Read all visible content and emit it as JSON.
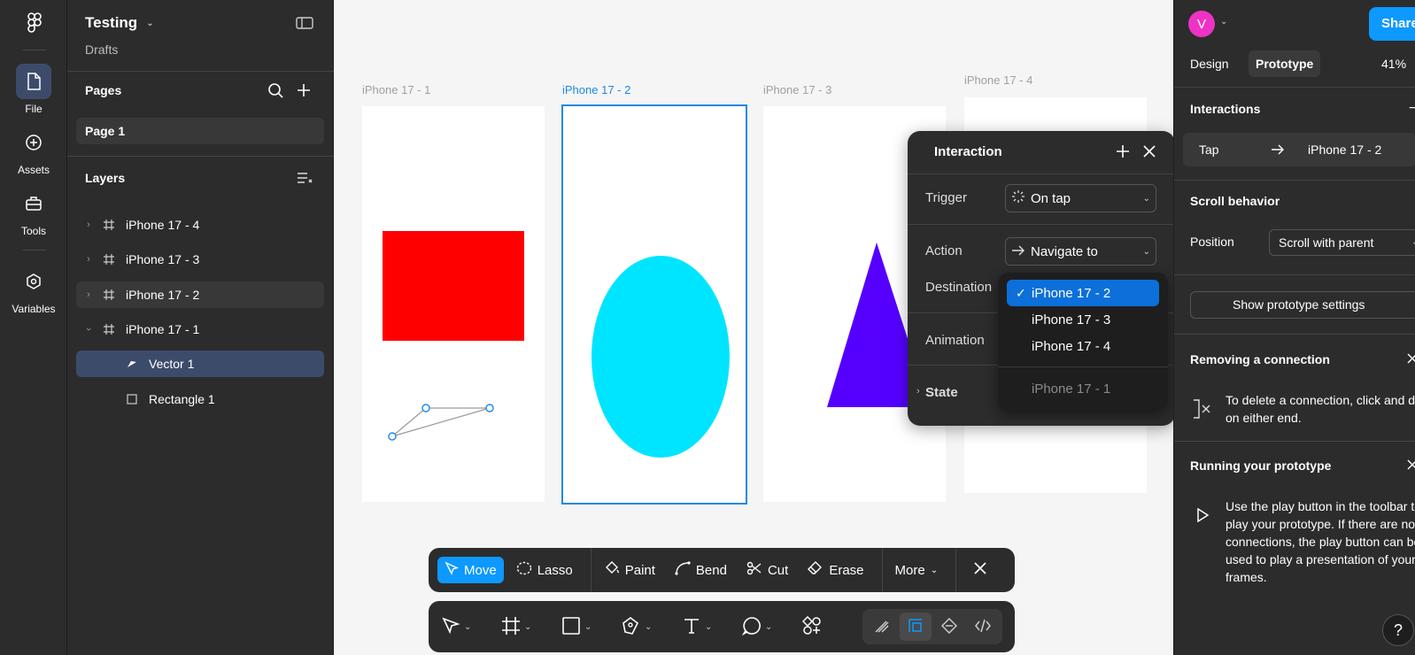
{
  "rail": {
    "items": [
      {
        "label": "File",
        "icon": "file-icon"
      },
      {
        "label": "Assets",
        "icon": "assets-icon"
      },
      {
        "label": "Tools",
        "icon": "toolbox-icon"
      },
      {
        "label": "Variables",
        "icon": "variables-icon"
      }
    ]
  },
  "project": {
    "title": "Testing",
    "subtitle": "Drafts"
  },
  "pages": {
    "title": "Pages",
    "items": [
      "Page 1"
    ]
  },
  "layers": {
    "title": "Layers",
    "items": [
      {
        "label": "iPhone 17 - 4"
      },
      {
        "label": "iPhone 17 - 3"
      },
      {
        "label": "iPhone 17 - 2"
      },
      {
        "label": "iPhone 17 - 1"
      },
      {
        "label": "Vector 1"
      },
      {
        "label": "Rectangle 1"
      }
    ]
  },
  "canvas": {
    "frames": [
      "iPhone 17 - 1",
      "iPhone 17 - 2",
      "iPhone 17 - 3",
      "iPhone 17 - 4"
    ],
    "colors": {
      "rectangle": "#ff0000",
      "ellipse": "#00e5ff",
      "triangle": "#5500ff",
      "selection": "#1e88e5"
    }
  },
  "toolbar1": {
    "move": "Move",
    "lasso": "Lasso",
    "paint": "Paint",
    "bend": "Bend",
    "cut": "Cut",
    "erase": "Erase",
    "more": "More"
  },
  "interaction_popup": {
    "title": "Interaction",
    "trigger_label": "Trigger",
    "trigger_value": "On tap",
    "action_label": "Action",
    "action_value": "Navigate to",
    "destination_label": "Destination",
    "animation_label": "Animation",
    "state_label": "State",
    "destination_options": [
      {
        "label": "iPhone 17 - 2",
        "selected": true
      },
      {
        "label": "iPhone 17 - 3"
      },
      {
        "label": "iPhone 17 - 4"
      },
      {
        "label": "iPhone 17 - 1",
        "disabled": true
      }
    ]
  },
  "right_panel": {
    "avatar_letter": "V",
    "share": "Share",
    "tabs": [
      "Design",
      "Prototype"
    ],
    "zoom": "41%",
    "interactions_title": "Interactions",
    "connection": {
      "trigger": "Tap",
      "target": "iPhone 17 - 2"
    },
    "scroll_title": "Scroll behavior",
    "position_label": "Position",
    "position_value": "Scroll with parent",
    "show_settings": "Show prototype settings",
    "removing_title": "Removing a connection",
    "removing_text": "To delete a connection, click and drag on either end.",
    "running_title": "Running your prototype",
    "running_text": "Use the play button in the toolbar to play your prototype. If there are no connections, the play button can be used to play a presentation of your frames.",
    "help": "?"
  }
}
